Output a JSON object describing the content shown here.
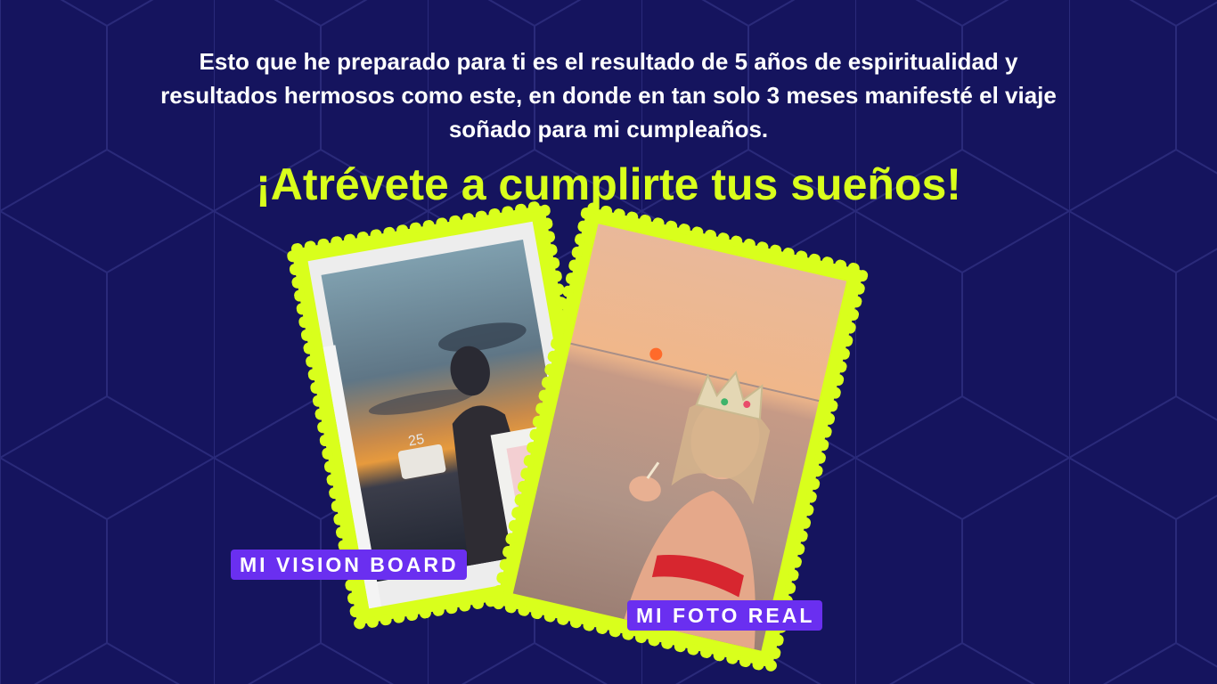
{
  "intro": {
    "text": "Esto que he preparado para ti es el resultado de 5 años de espiritualidad y resultados hermosos como este, en donde en tan solo 3 meses manifesté el viaje soñado para mi cumpleaños."
  },
  "headline": {
    "text": "¡Atrévete a cumplirte tus sueños!"
  },
  "photos": {
    "vision_board": {
      "label": "MI VISION BOARD",
      "cake_number": "25"
    },
    "real_photo": {
      "label": "MI FOTO REAL"
    }
  },
  "colors": {
    "background": "#15145e",
    "accent": "#d9ff1c",
    "tag": "#6a2ff0",
    "text": "#ffffff"
  }
}
